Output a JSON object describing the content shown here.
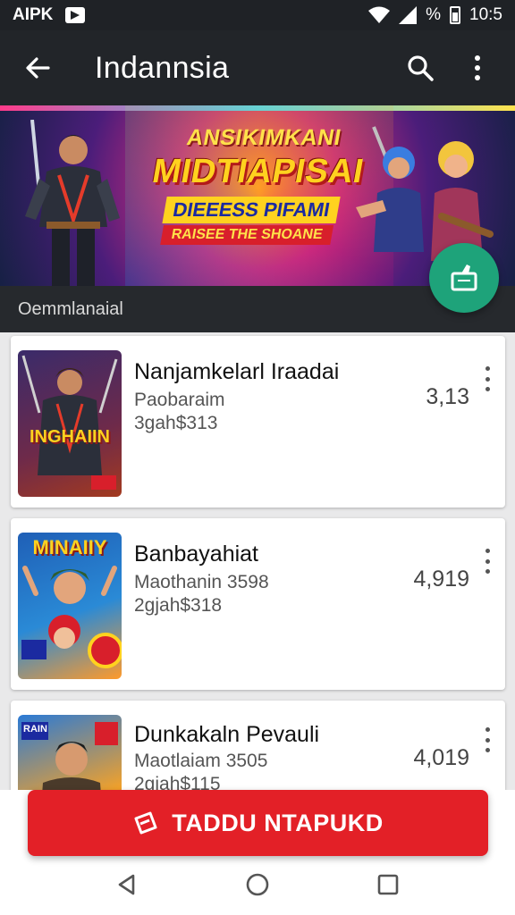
{
  "status_bar": {
    "carrier": "AIPK",
    "percent_symbol": "%",
    "time": "10:5"
  },
  "app_bar": {
    "title": "Indannsia",
    "back_icon": "arrow-back-icon",
    "search_icon": "search-icon",
    "more_icon": "more-vert-icon"
  },
  "banner": {
    "line1": "ANSIKIMKANI",
    "line2": "MIDTIAPISAI",
    "line3": "DIEEESS PIFAMI",
    "line4": "RAISEE THE SHOANE",
    "caption": "Oemmlanaial",
    "fab_icon": "like-icon",
    "accent_color": "#1ea37a"
  },
  "list": {
    "items": [
      {
        "title": "Nanjamkelarl Iraadai",
        "subtitle": "Paobaraim",
        "meta": "3gah$313",
        "score": "3,13",
        "thumb_label": "INGHAIIN"
      },
      {
        "title": "Banbayahiat",
        "subtitle": "Maothanin 3598",
        "meta": "2gjah$318",
        "score": "4,919",
        "thumb_label": "MINAIIY"
      },
      {
        "title": "Dunkakaln Pevauli",
        "subtitle": "Maotlaiam 3505",
        "meta": "2gjah$115",
        "score": "4,019",
        "thumb_label": "RAIN"
      }
    ]
  },
  "cta": {
    "label": "TADDU NTAPUKD",
    "icon": "ticket-icon",
    "color": "#e32027"
  },
  "nav": {
    "back_icon": "nav-back-icon",
    "home_icon": "nav-home-icon",
    "recents_icon": "nav-recents-icon"
  }
}
